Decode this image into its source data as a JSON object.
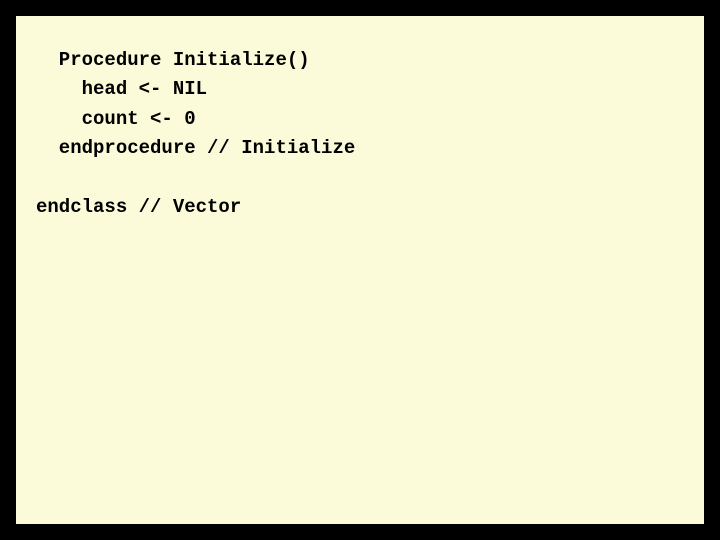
{
  "code": {
    "line1": "  Procedure Initialize()",
    "line2": "    head <- NIL",
    "line3": "    count <- 0",
    "line4": "  endprocedure // Initialize",
    "line5": "",
    "line6": "endclass // Vector"
  }
}
